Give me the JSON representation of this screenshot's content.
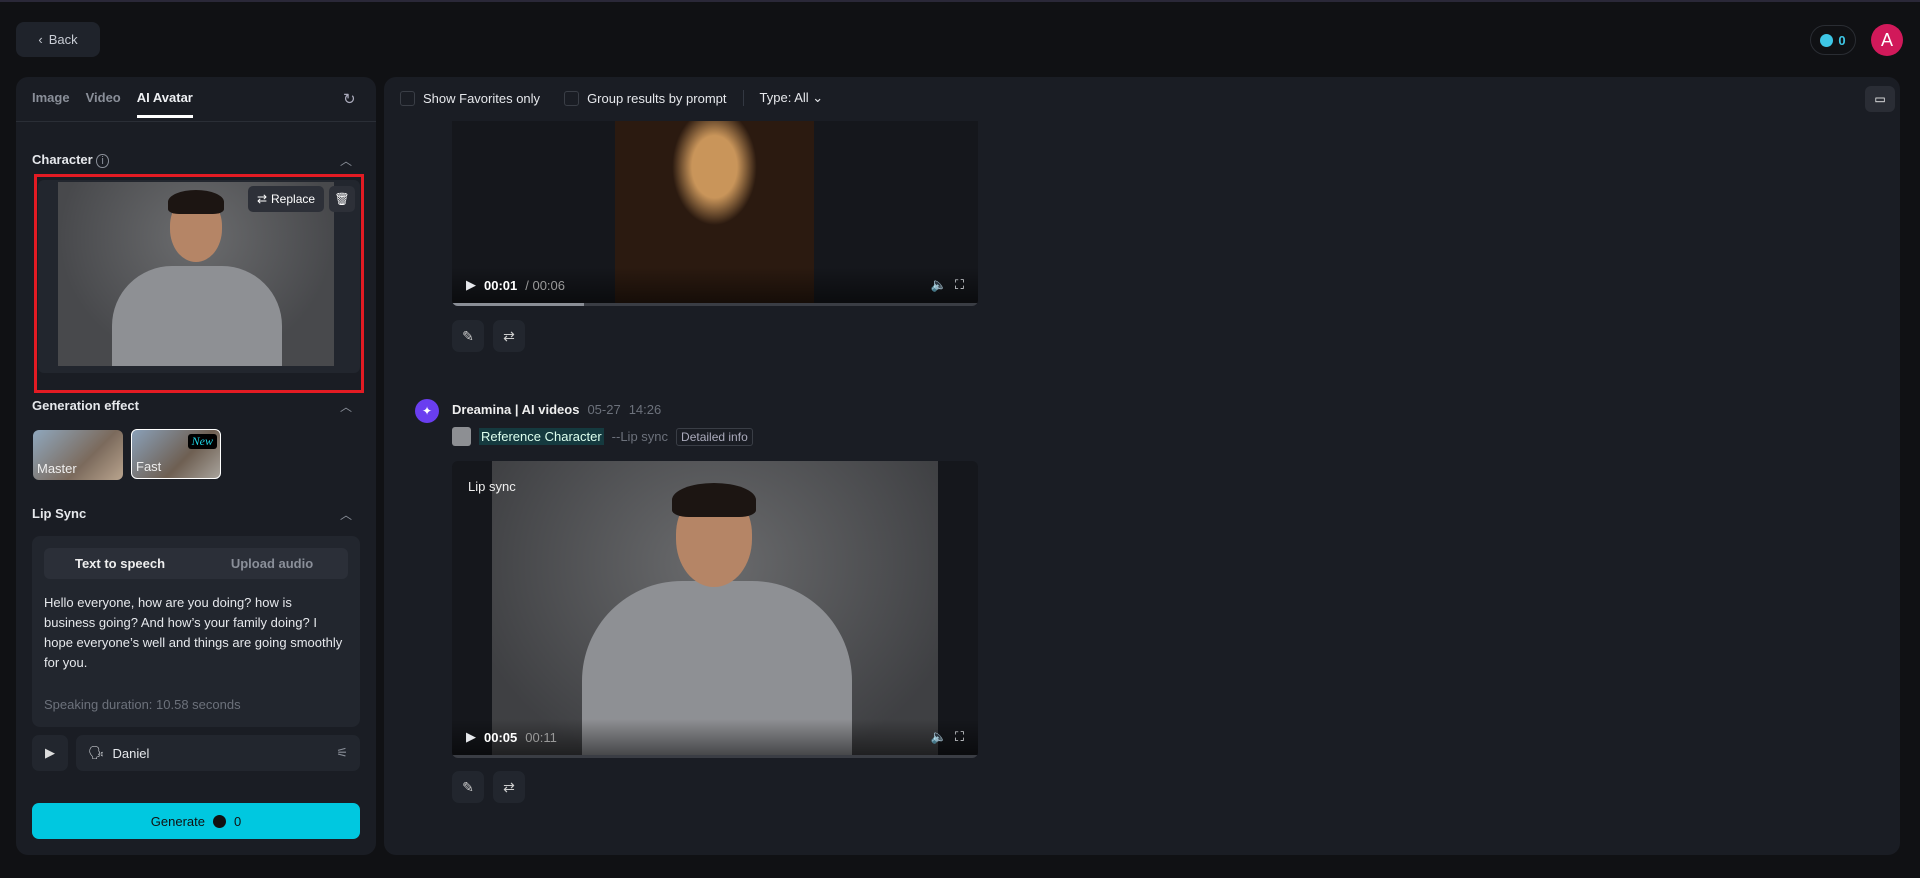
{
  "header": {
    "back_label": "Back",
    "credits": "0",
    "avatar_initial": "A"
  },
  "left": {
    "tabs": [
      {
        "label": "Image"
      },
      {
        "label": "Video"
      },
      {
        "label": "AI Avatar"
      }
    ],
    "character": {
      "title": "Character",
      "replace_label": "Replace"
    },
    "generation_effect": {
      "title": "Generation effect",
      "options": [
        {
          "label": "Master"
        },
        {
          "label": "Fast",
          "badge": "New"
        }
      ],
      "selected": "Fast"
    },
    "lip_sync": {
      "title": "Lip Sync",
      "modes": [
        "Text to speech",
        "Upload audio"
      ],
      "active_mode": "Text to speech",
      "script": "Hello everyone, how are you doing? how is business going?  And how’s your family doing? I hope everyone’s well and things are going smoothly for you.",
      "duration": "Speaking duration: 10.58 seconds",
      "voice": "Daniel"
    },
    "generate": {
      "label": "Generate",
      "cost": "0"
    }
  },
  "toolbar": {
    "show_favorites": "Show Favorites only",
    "group_results": "Group results by prompt",
    "type_filter": "Type: All"
  },
  "results": [
    {
      "current": "00:01",
      "total": "/ 00:06",
      "progress": 0.25
    },
    {
      "author": "Dreamina | AI videos",
      "date": "05-27",
      "time": "14:26",
      "reference": "Reference Character",
      "mode": "--Lip sync",
      "details": "Detailed info",
      "overlay": "Lip sync",
      "current": "00:05",
      "total": "00:11",
      "progress": 0.0
    }
  ],
  "colors": {
    "accent": "#00c8e0",
    "highlight": "#e31b23",
    "avatar": "#d1195a"
  }
}
